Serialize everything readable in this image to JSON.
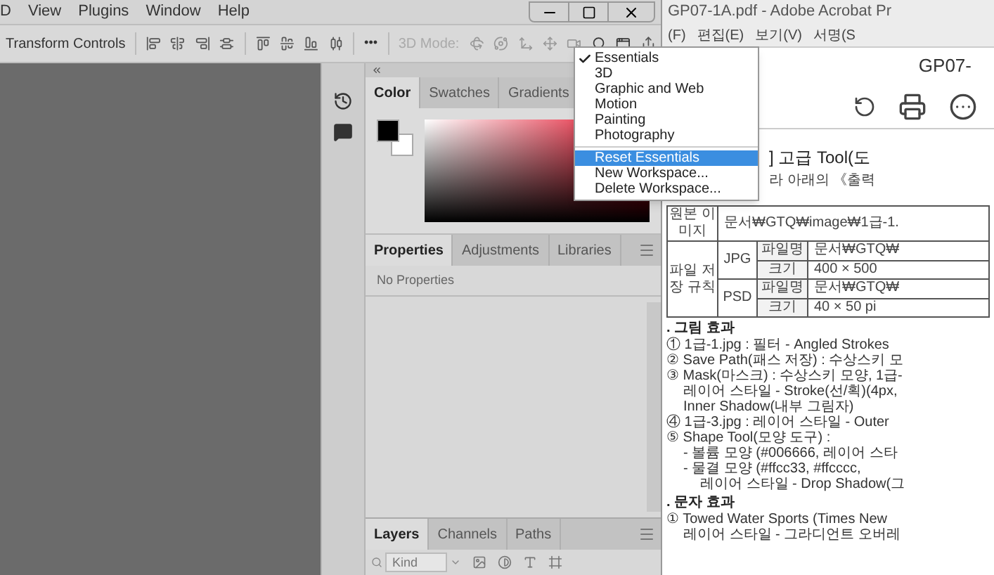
{
  "photoshop": {
    "menu_bar": [
      "D",
      "View",
      "Plugins",
      "Window",
      "Help"
    ],
    "options_bar": {
      "label": "Transform Controls",
      "more": "•••",
      "mode_label": "3D Mode:"
    },
    "color_panel": {
      "tabs": [
        {
          "label": "Color",
          "selected": true
        },
        {
          "label": "Swatches",
          "selected": false
        },
        {
          "label": "Gradients",
          "selected": false
        }
      ]
    },
    "properties_panel": {
      "tabs": [
        {
          "label": "Properties",
          "selected": true
        },
        {
          "label": "Adjustments",
          "selected": false
        },
        {
          "label": "Libraries",
          "selected": false
        }
      ],
      "message": "No Properties"
    },
    "layers_panel": {
      "tabs": [
        {
          "label": "Layers",
          "selected": true
        },
        {
          "label": "Channels",
          "selected": false
        },
        {
          "label": "Paths",
          "selected": false
        }
      ],
      "search": {
        "placeholder": "Kind"
      }
    },
    "workspace_menu": {
      "groups": [
        {
          "items": [
            {
              "label": "Essentials",
              "checked": true,
              "highlighted": false
            },
            {
              "label": "3D",
              "checked": false,
              "highlighted": false
            },
            {
              "label": "Graphic and Web",
              "checked": false,
              "highlighted": false
            },
            {
              "label": "Motion",
              "checked": false,
              "highlighted": false
            },
            {
              "label": "Painting",
              "checked": false,
              "highlighted": false
            },
            {
              "label": "Photography",
              "checked": false,
              "highlighted": false
            }
          ]
        },
        {
          "items": [
            {
              "label": "Reset Essentials",
              "checked": false,
              "highlighted": true
            },
            {
              "label": "New Workspace...",
              "checked": false,
              "highlighted": false
            },
            {
              "label": "Delete Workspace...",
              "checked": false,
              "highlighted": false
            }
          ]
        }
      ]
    }
  },
  "acrobat": {
    "title": "GP07-1A.pdf - Adobe Acrobat Pr",
    "menu": [
      "(F)",
      "편집(E)",
      "보기(V)",
      "서명(S"
    ],
    "document_title": "GP07-",
    "heading": "] 고급 Tool(도",
    "instruction": "라 아래의 《출력",
    "table": {
      "original_image": {
        "label": "원본 이미지",
        "value": "문서₩GTQ₩image₩1급-1."
      },
      "save_rule": {
        "label": "파일 저장 규칙",
        "formats": [
          {
            "name": "JPG",
            "rows": [
              {
                "field": "파일명",
                "value": "문서₩GTQ₩"
              },
              {
                "field": "크기",
                "value": "400 × 500"
              }
            ]
          },
          {
            "name": "PSD",
            "rows": [
              {
                "field": "파일명",
                "value": "문서₩GTQ₩"
              },
              {
                "field": "크기",
                "value": "40 × 50 pi"
              }
            ]
          }
        ]
      }
    },
    "sections": [
      {
        "heading": ". 그림 효과",
        "items": [
          {
            "text": "① 1급-1.jpg : 필터 - Angled Strokes"
          },
          {
            "text": "② Save Path(패스 저장) : 수상스키 모"
          },
          {
            "text": "③ Mask(마스크) : 수상스키 모양, 1급-",
            "children": [
              {
                "text": "레이어 스타일 - Stroke(선/획)(4px,"
              },
              {
                "text": "Inner Shadow(내부 그림자)"
              }
            ]
          },
          {
            "text": "④ 1급-3.jpg : 레이어 스타일 - Outer"
          },
          {
            "text": "⑤ Shape Tool(모양 도구) :",
            "children": [
              {
                "text": "- 볼륨 모양 (#006666, 레이어 스타"
              },
              {
                "text": "- 물결 모양 (#ffcc33, #ffcccc,",
                "children": [
                  {
                    "text": "레이어 스타일 - Drop Shadow(그"
                  }
                ]
              }
            ]
          }
        ]
      },
      {
        "heading": ". 문자 효과",
        "items": [
          {
            "text": "① Towed Water Sports (Times New",
            "children": [
              {
                "text": "레이어 스타일 - 그라디언트 오버레"
              }
            ]
          }
        ]
      }
    ]
  }
}
